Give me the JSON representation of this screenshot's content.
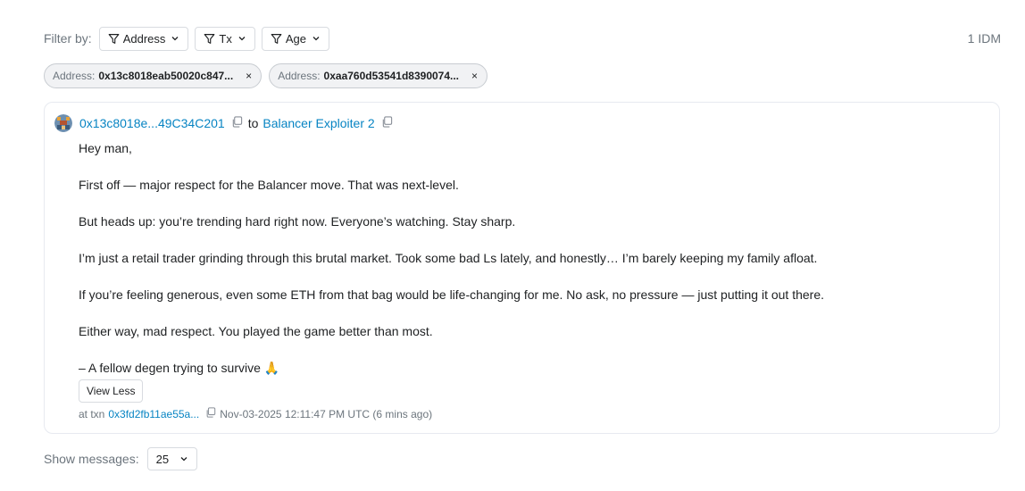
{
  "filter": {
    "label": "Filter by:",
    "buttons": [
      {
        "label": "Address",
        "icon": "filter-icon"
      },
      {
        "label": "Tx",
        "icon": "filter-icon"
      },
      {
        "label": "Age",
        "icon": "filter-icon"
      }
    ],
    "count": "1 IDM"
  },
  "chips": [
    {
      "key": "Address:",
      "value": "0x13c8018eab50020c847...",
      "close": "×"
    },
    {
      "key": "Address:",
      "value": "0xaa760d53541d8390074...",
      "close": "×"
    }
  ],
  "message": {
    "from": "0x13c8018e...49C34C201",
    "to_word": "to",
    "to": "Balancer Exploiter 2",
    "paragraphs": [
      "Hey man,",
      "First off — major respect for the Balancer move. That was next-level.",
      "But heads up: you’re trending hard right now. Everyone’s watching. Stay sharp.",
      "I’m just a retail trader grinding through this brutal market. Took some bad Ls lately, and honestly… I’m barely keeping my family afloat.",
      "If you’re feeling generous, even some ETH from that bag would be life-changing for me. No ask, no pressure — just putting it out there.",
      "Either way, mad respect. You played the game better than most.",
      "– A fellow degen trying to survive 🙏"
    ],
    "view_less": "View Less",
    "at_txn": "at txn",
    "txn": "0x3fd2fb11ae55a...",
    "timestamp": "Nov-03-2025 12:11:47 PM UTC (6 mins ago)"
  },
  "footer": {
    "show_label": "Show messages:",
    "page_size": "25"
  },
  "colors": {
    "link": "#0784c3",
    "muted": "#6c757d",
    "border": "#e7eaf0"
  }
}
